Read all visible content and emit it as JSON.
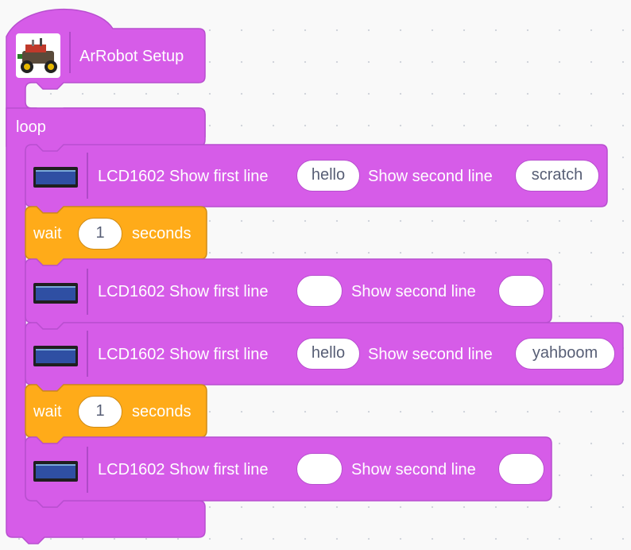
{
  "colors": {
    "control_block": "#d65ce8",
    "wait_block": "#ffab19",
    "workspace": "#f9f9f9"
  },
  "setup_block": {
    "icon": "arrobot-car-icon",
    "label": "ArRobot Setup"
  },
  "loop_block": {
    "label": "loop"
  },
  "script": [
    {
      "kind": "lcd",
      "icon": "lcd1602-icon",
      "label_first": "LCD1602 Show first line",
      "first_line": "hello",
      "label_second": "Show second line",
      "second_line": "scratch"
    },
    {
      "kind": "wait",
      "label_wait": "wait",
      "seconds": "1",
      "label_seconds": "seconds"
    },
    {
      "kind": "lcd",
      "icon": "lcd1602-icon",
      "label_first": "LCD1602 Show first line",
      "first_line": "",
      "label_second": "Show second line",
      "second_line": ""
    },
    {
      "kind": "lcd",
      "icon": "lcd1602-icon",
      "label_first": "LCD1602 Show first line",
      "first_line": "hello",
      "label_second": "Show second line",
      "second_line": "yahboom"
    },
    {
      "kind": "wait",
      "label_wait": "wait",
      "seconds": "1",
      "label_seconds": "seconds"
    },
    {
      "kind": "lcd",
      "icon": "lcd1602-icon",
      "label_first": "LCD1602 Show first line",
      "first_line": "",
      "label_second": "Show second line",
      "second_line": ""
    }
  ]
}
